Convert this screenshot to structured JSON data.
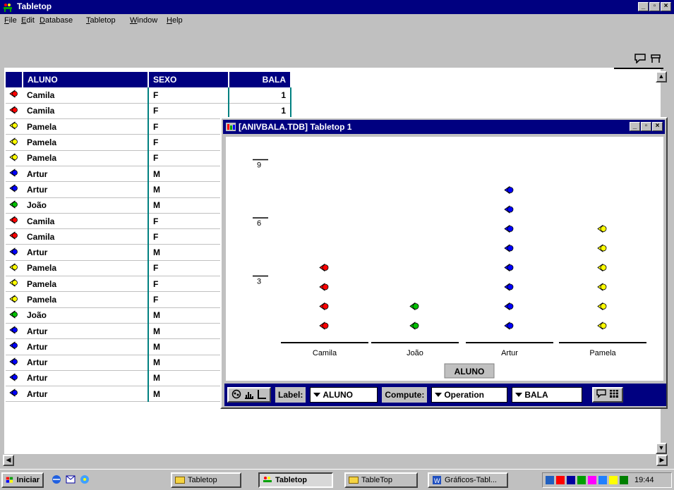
{
  "window": {
    "title": "Tabletop"
  },
  "menu": [
    "File",
    "Edit",
    "Database",
    "Tabletop",
    "Window",
    "Help"
  ],
  "icons": {
    "window_controls": [
      "minimize-icon",
      "maximize-icon",
      "close-icon"
    ],
    "toolbar": [
      "comment-icon",
      "table-icon"
    ]
  },
  "table": {
    "headers": [
      "ALUNO",
      "SEXO",
      "BALA"
    ],
    "rows": [
      {
        "aluno": "Camila",
        "sexo": "F",
        "bala": "1",
        "color": "#ff0000"
      },
      {
        "aluno": "Camila",
        "sexo": "F",
        "bala": "1",
        "color": "#ff0000"
      },
      {
        "aluno": "Pamela",
        "sexo": "F",
        "bala": "",
        "color": "#ffff00"
      },
      {
        "aluno": "Pamela",
        "sexo": "F",
        "bala": "",
        "color": "#ffff00"
      },
      {
        "aluno": "Pamela",
        "sexo": "F",
        "bala": "",
        "color": "#ffff00"
      },
      {
        "aluno": "Artur",
        "sexo": "M",
        "bala": "",
        "color": "#0000ff"
      },
      {
        "aluno": "Artur",
        "sexo": "M",
        "bala": "",
        "color": "#0000ff"
      },
      {
        "aluno": "João",
        "sexo": "M",
        "bala": "",
        "color": "#00c000"
      },
      {
        "aluno": "Camila",
        "sexo": "F",
        "bala": "",
        "color": "#ff0000"
      },
      {
        "aluno": "Camila",
        "sexo": "F",
        "bala": "",
        "color": "#ff0000"
      },
      {
        "aluno": "Artur",
        "sexo": "M",
        "bala": "",
        "color": "#0000ff"
      },
      {
        "aluno": "Pamela",
        "sexo": "F",
        "bala": "",
        "color": "#ffff00"
      },
      {
        "aluno": "Pamela",
        "sexo": "F",
        "bala": "",
        "color": "#ffff00"
      },
      {
        "aluno": "Pamela",
        "sexo": "F",
        "bala": "",
        "color": "#ffff00"
      },
      {
        "aluno": "João",
        "sexo": "M",
        "bala": "",
        "color": "#00c000"
      },
      {
        "aluno": "Artur",
        "sexo": "M",
        "bala": "",
        "color": "#0000ff"
      },
      {
        "aluno": "Artur",
        "sexo": "M",
        "bala": "",
        "color": "#0000ff"
      },
      {
        "aluno": "Artur",
        "sexo": "M",
        "bala": "",
        "color": "#0000ff"
      },
      {
        "aluno": "Artur",
        "sexo": "M",
        "bala": "",
        "color": "#0000ff"
      },
      {
        "aluno": "Artur",
        "sexo": "M",
        "bala": "",
        "color": "#0000ff"
      }
    ]
  },
  "subwindow": {
    "title": "[ANIVBALA.TDB] Tabletop 1",
    "axis_label": "ALUNO",
    "bottom": {
      "label_caption": "Label:",
      "label_value": "ALUNO",
      "compute_caption": "Compute:",
      "compute_value": "Operation",
      "compute_field": "BALA"
    }
  },
  "chart_data": {
    "type": "scatter",
    "categories": [
      "Camila",
      "João",
      "Artur",
      "Pamela"
    ],
    "counts": [
      4,
      2,
      8,
      6
    ],
    "colors": [
      "#ff0000",
      "#00c000",
      "#0000ff",
      "#ffff00"
    ],
    "yticks": [
      "3",
      "6",
      "9"
    ],
    "xlabel": "ALUNO"
  },
  "taskbar": {
    "start": "Iniciar",
    "buttons": [
      "Tabletop",
      "Tabletop",
      "TableTop",
      "Gráficos-Tabl..."
    ],
    "clock": "19:44"
  }
}
